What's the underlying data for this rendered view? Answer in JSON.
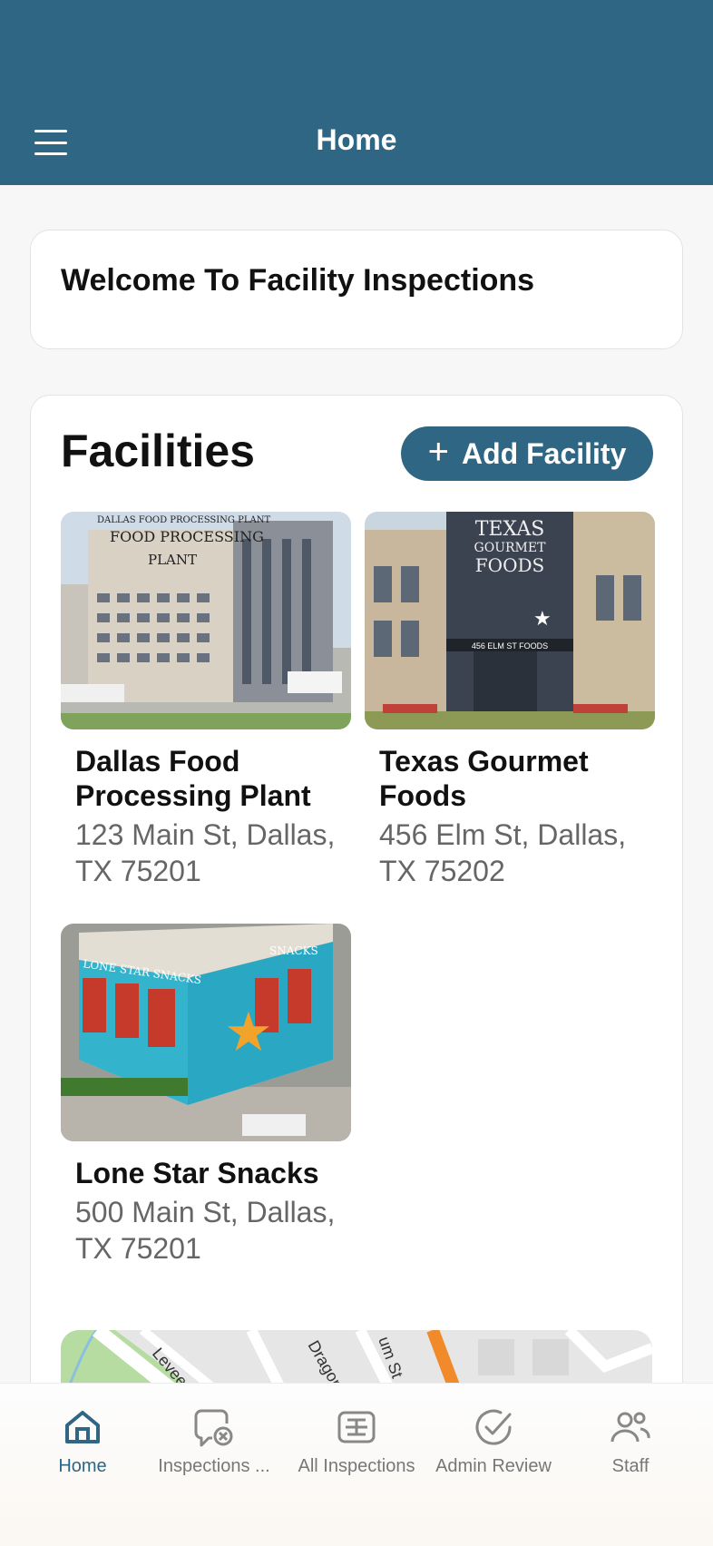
{
  "header": {
    "title": "Home",
    "menu_icon": "hamburger-icon"
  },
  "welcome": {
    "text": "Welcome To Facility Inspections"
  },
  "facilities": {
    "title": "Facilities",
    "add_button": {
      "label": "Add Facility",
      "icon": "plus-icon"
    },
    "items": [
      {
        "name": "Dallas Food Processing Plant",
        "address": "123 Main St, Dallas, TX 75201",
        "image_text": [
          "DALLAS FOOD PROCESSING PLANT",
          "FOOD PROCESSING",
          "PLANT"
        ]
      },
      {
        "name": "Texas Gourmet Foods",
        "address": "456 Elm St, Dallas, TX 75202",
        "image_text": [
          "TEXAS",
          "GOURMET",
          "FOODS",
          "456 ELM ST FOODS"
        ]
      },
      {
        "name": "Lone Star Snacks",
        "address": "500 Main St, Dallas, TX 75201",
        "image_text": [
          "LONE STAR SNACKS",
          "SNACKS"
        ]
      }
    ]
  },
  "map": {
    "labels": [
      "Levee St",
      "Dragon St",
      "um St"
    ]
  },
  "tabs": [
    {
      "label": "Home",
      "icon": "home-icon",
      "active": true
    },
    {
      "label": "Inspections ...",
      "icon": "chat-cancel-icon",
      "active": false
    },
    {
      "label": "All Inspections",
      "icon": "list-box-icon",
      "active": false
    },
    {
      "label": "Admin Review",
      "icon": "check-circle-icon",
      "active": false
    },
    {
      "label": "Staff",
      "icon": "people-icon",
      "active": false
    }
  ],
  "colors": {
    "brand": "#2f6684",
    "background": "#f7f7f7",
    "muted_text": "#666666"
  }
}
